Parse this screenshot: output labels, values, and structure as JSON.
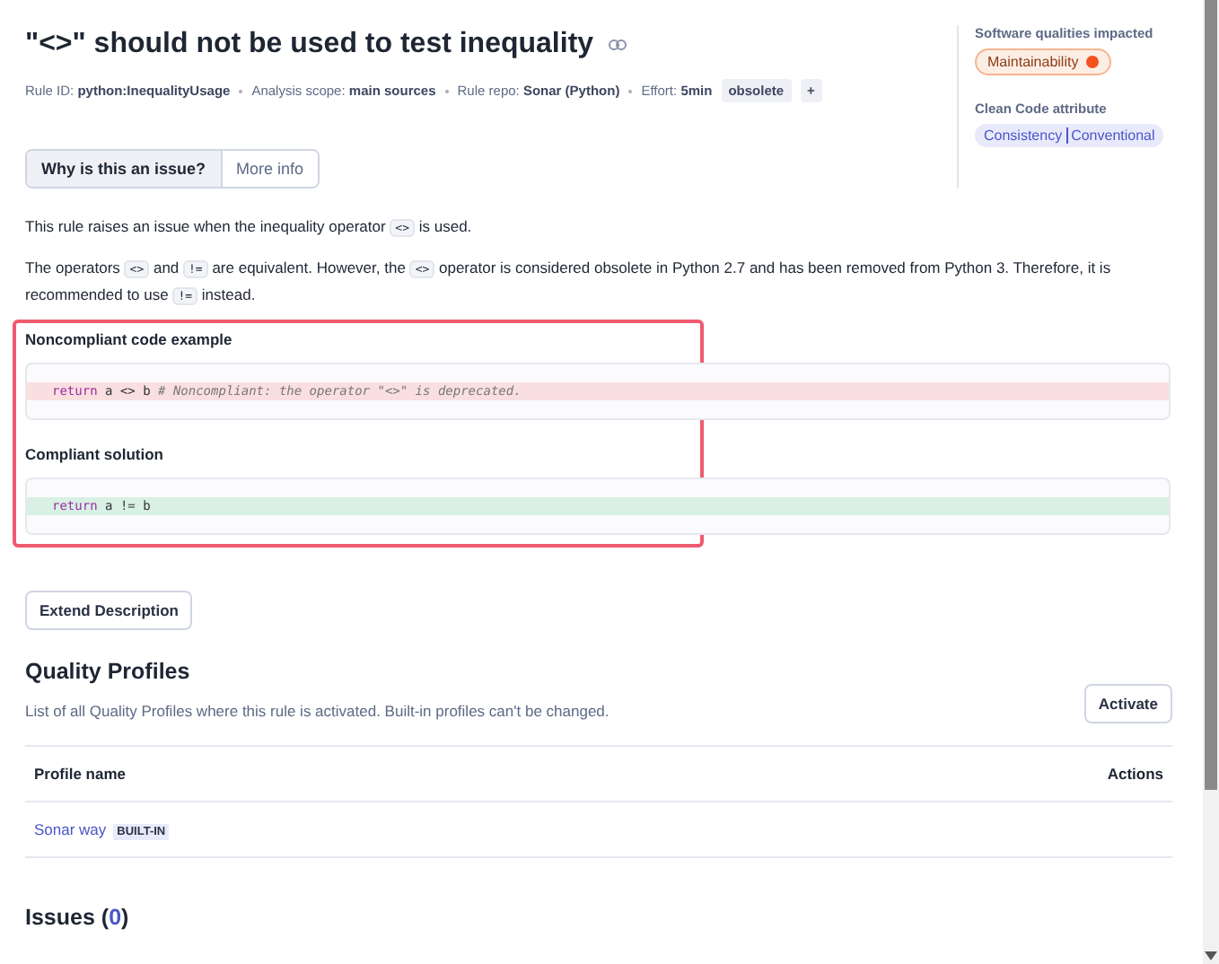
{
  "title": "\"<>\" should not be used to test inequality",
  "meta": [
    {
      "label": "Rule ID:",
      "value": "python:InequalityUsage"
    },
    {
      "label": "Analysis scope:",
      "value": "main sources"
    },
    {
      "label": "Rule repo:",
      "value": "Sonar (Python)"
    },
    {
      "label": "Effort:",
      "value": "5min"
    }
  ],
  "tags": [
    "obsolete",
    "+"
  ],
  "qualities": {
    "title": "Software qualities impacted",
    "items": [
      {
        "label": "Maintainability",
        "color": "#f4511e"
      }
    ]
  },
  "clean_code": {
    "title": "Clean Code attribute",
    "category": "Consistency",
    "attribute": "Conventional"
  },
  "tabs": [
    {
      "label": "Why is this an issue?",
      "selected": true
    },
    {
      "label": "More info",
      "selected": false
    }
  ],
  "paragraphs": [
    [
      {
        "kind": "text",
        "text": "This rule raises an issue when the inequality operator "
      },
      {
        "kind": "code",
        "text": "<>"
      },
      {
        "kind": "text",
        "text": " is used."
      }
    ],
    [
      {
        "kind": "text",
        "text": "The operators "
      },
      {
        "kind": "code",
        "text": "<>"
      },
      {
        "kind": "text",
        "text": " and "
      },
      {
        "kind": "code",
        "text": "!="
      },
      {
        "kind": "text",
        "text": " are equivalent. However, the "
      },
      {
        "kind": "code",
        "text": "<>"
      },
      {
        "kind": "text",
        "text": " operator is considered obsolete in Python 2.7 and has been removed from Python 3. Therefore, it is recommended to use "
      },
      {
        "kind": "code",
        "text": "!="
      },
      {
        "kind": "text",
        "text": " instead."
      }
    ]
  ],
  "examples": [
    {
      "heading": "Noncompliant code example",
      "kind": "noncompliant",
      "keyword": "return",
      "code": " a <> b ",
      "comment": "# Noncompliant: the operator \"<>\" is deprecated."
    },
    {
      "heading": "Compliant solution",
      "kind": "compliant",
      "keyword": "return",
      "code": " a != b"
    }
  ],
  "extend_button": "Extend Description",
  "quality_profiles": {
    "title": "Quality Profiles",
    "description": "List of all Quality Profiles where this rule is activated. Built-in profiles can't be changed.",
    "activate_button": "Activate",
    "columns": [
      "Profile name",
      "Actions"
    ],
    "rows": [
      {
        "name": "Sonar way",
        "badge": "BUILT-IN"
      }
    ]
  },
  "issues": {
    "label": "Issues (",
    "count": "0",
    "close": ")"
  }
}
